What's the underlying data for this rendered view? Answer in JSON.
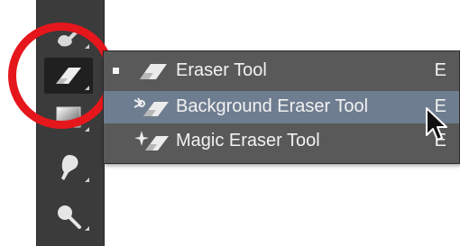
{
  "toolbar": {
    "tools": [
      {
        "name": "brush-icon"
      },
      {
        "name": "eraser-icon"
      },
      {
        "name": "gradient-icon"
      },
      {
        "name": "blur-icon"
      },
      {
        "name": "dodge-icon"
      }
    ]
  },
  "flyout": {
    "items": [
      {
        "label": "Eraser Tool",
        "shortcut": "E",
        "selected": true
      },
      {
        "label": "Background Eraser Tool",
        "shortcut": "E",
        "highlighted": true
      },
      {
        "label": "Magic Eraser Tool",
        "shortcut": "E"
      }
    ]
  },
  "colors": {
    "highlight_ring": "#e5171c",
    "menu_background": "#595959",
    "menu_highlight": "#6f7d90",
    "toolbar_background": "#3b3b3b"
  }
}
